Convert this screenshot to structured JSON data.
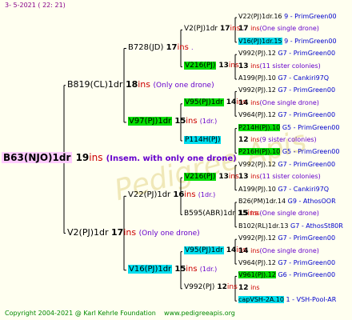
{
  "header": {
    "date": "3-  5-2021 ( 22: 21)"
  },
  "watermark": {
    "text": "Pedigree Apis"
  },
  "footer": {
    "copyright": "Copyright 2004-2021 @ Karl Kehrle Foundation",
    "site": "www.pedigreeapis.org"
  },
  "colors": {
    "red": "#cc0000",
    "purple": "#6600cc",
    "blue": "#0000cc",
    "green_hl": "#00dd00",
    "cyan_hl": "#00ddee",
    "pink_hl": "#ffccff",
    "line": "#000000",
    "footer": "#008800"
  },
  "root": {
    "name": "B63(NJO)1dr",
    "ins": "19",
    "ins_word": "ins",
    "note": "(Insem. with only one drone)"
  },
  "gen1": [
    {
      "name": "B819(CL)1dr",
      "ins": "18",
      "ins_word": "ins",
      "note": "(Only one drone)"
    },
    {
      "name": "V2(PJ)1dr",
      "ins": "17",
      "ins_word": "ins",
      "note": "(Only one drone)"
    }
  ],
  "gen2": [
    {
      "name": "B728(JD)",
      "ins": "17",
      "ins_word": "ins",
      "note": "."
    },
    {
      "name": "V97(PJ)1dr",
      "ins": "15",
      "ins_word": "ins",
      "note": "(1dr.)"
    },
    {
      "name": "V22(PJ)1dr",
      "ins": "16",
      "ins_word": "ins",
      "note": "(1dr.)"
    },
    {
      "name": "V16(PJ)1dr",
      "ins": "15",
      "ins_word": "ins",
      "note": "(1dr.)"
    }
  ],
  "gen3": [
    {
      "name": "V2(PJ)1dr",
      "ins": "17",
      "ins_word": "ins",
      "note": "."
    },
    {
      "name": "V216(PJ)",
      "ins": "13",
      "ins_word": "ins",
      "note": ""
    },
    {
      "name": "V95(PJ)1dr",
      "ins": "14",
      "ins_word": "ins",
      "note": ""
    },
    {
      "name": "P114H(PJ)",
      "ins": "",
      "ins_word": "",
      "note": ""
    },
    {
      "name": "V216(PJ)",
      "ins": "13",
      "ins_word": "ins",
      "note": ""
    },
    {
      "name": "B595(ABR)1dr",
      "ins": "15",
      "ins_word": "ins",
      "note": ""
    },
    {
      "name": "V95(PJ)1dr",
      "ins": "14",
      "ins_word": "ins",
      "note": ""
    },
    {
      "name": "V992(PJ)",
      "ins": "12",
      "ins_word": "ins",
      "note": ""
    }
  ],
  "gen4": [
    {
      "name": "V22(PJ)1dr.16",
      "src": "9 - PrimGreen00"
    },
    {
      "ins": "17",
      "ins_word": "ins",
      "note": "(One single drone)"
    },
    {
      "name": "V16(PJ)1dr.15",
      "src": "9 - PrimGreen00"
    },
    {
      "name": "V992(PJ).12",
      "src": "G7 - PrimGreen00"
    },
    {
      "ins": "13",
      "ins_word": "ins",
      "note": "(11 sister colonies)"
    },
    {
      "name": "A199(PJ).10",
      "src": "G7 - Cankiri97Q"
    },
    {
      "name": "V992(PJ).12",
      "src": "G7 - PrimGreen00"
    },
    {
      "ins": "14",
      "ins_word": "ins",
      "note": "(One single drone)"
    },
    {
      "name": "V964(PJ).12",
      "src": "G7 - PrimGreen00"
    },
    {
      "name": "P214H(PJ).10",
      "src": "G5 - PrimGreen00"
    },
    {
      "ins": "12",
      "ins_word": "ins",
      "note": "(9 sister colonies)"
    },
    {
      "name": "P216H(PJ).10",
      "src": "G5 - PrimGreen00"
    },
    {
      "name": "V992(PJ).12",
      "src": "G7 - PrimGreen00"
    },
    {
      "ins": "13",
      "ins_word": "ins",
      "note": "(11 sister colonies)"
    },
    {
      "name": "A199(PJ).10",
      "src": "G7 - Cankiri97Q"
    },
    {
      "name": "B26(PM)1dr.14",
      "src": "G9 - AthosOOR"
    },
    {
      "ins": "15",
      "ins_word": "ins",
      "note": "(One single drone)"
    },
    {
      "name": "B102(RL)1dr.13",
      "src": "G7 - AthosSt80R"
    },
    {
      "name": "V992(PJ).12",
      "src": "G7 - PrimGreen00"
    },
    {
      "ins": "14",
      "ins_word": "ins",
      "note": "(One single drone)"
    },
    {
      "name": "V964(PJ).12",
      "src": "G7 - PrimGreen00"
    },
    {
      "name": "V961(PJ).12",
      "src": "G6 - PrimGreen00"
    },
    {
      "ins": "12",
      "ins_word": "ins",
      "note": ""
    },
    {
      "name": "capVSH-2A.10",
      "src": "1 - VSH-Pool-AR"
    }
  ]
}
